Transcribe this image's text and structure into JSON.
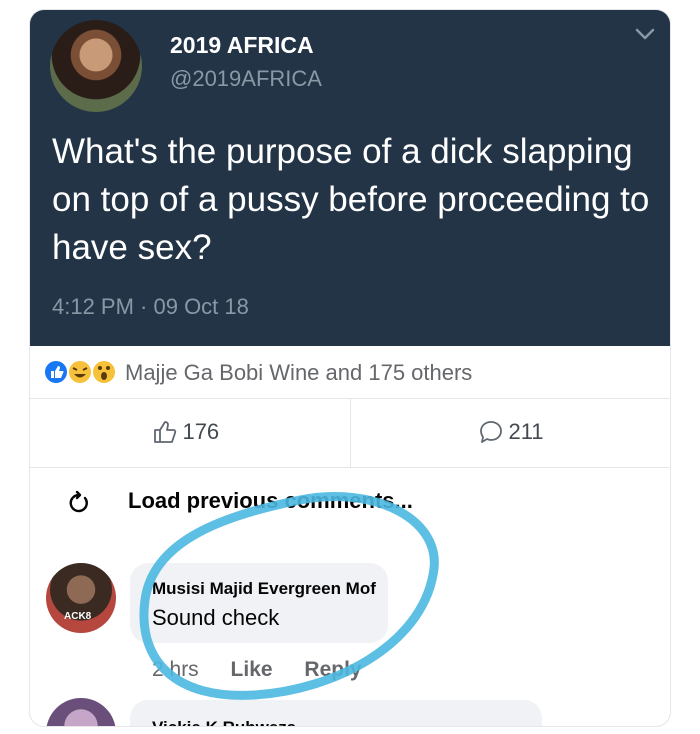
{
  "tweet": {
    "display_name": "2019 AFRICA",
    "handle": "@2019AFRICA",
    "text": "What's the purpose of a dick slapping on top of a pussy before proceeding to have sex?",
    "timestamp": "4:12 PM · 09 Oct 18",
    "avatar_icon": "profile-photo",
    "menu_icon": "chevron-down-icon",
    "background_color": "#243447"
  },
  "post": {
    "reactions_text": "Majje Ga Bobi Wine and 175 others",
    "reaction_icons": [
      "like-reaction-icon",
      "haha-reaction-icon",
      "wow-reaction-icon"
    ],
    "like_count": "176",
    "comment_count": "211",
    "load_previous_label": "Load previous comments..."
  },
  "comments": [
    {
      "author": "Musisi Majid Evergreen Mof",
      "text": "Sound check",
      "time": "2 hrs",
      "like_label": "Like",
      "reply_label": "Reply",
      "avatar_tag": "ACK8"
    },
    {
      "author": "Vickie K Ruhweza"
    }
  ],
  "annotation": {
    "color": "#4bb8e0"
  }
}
